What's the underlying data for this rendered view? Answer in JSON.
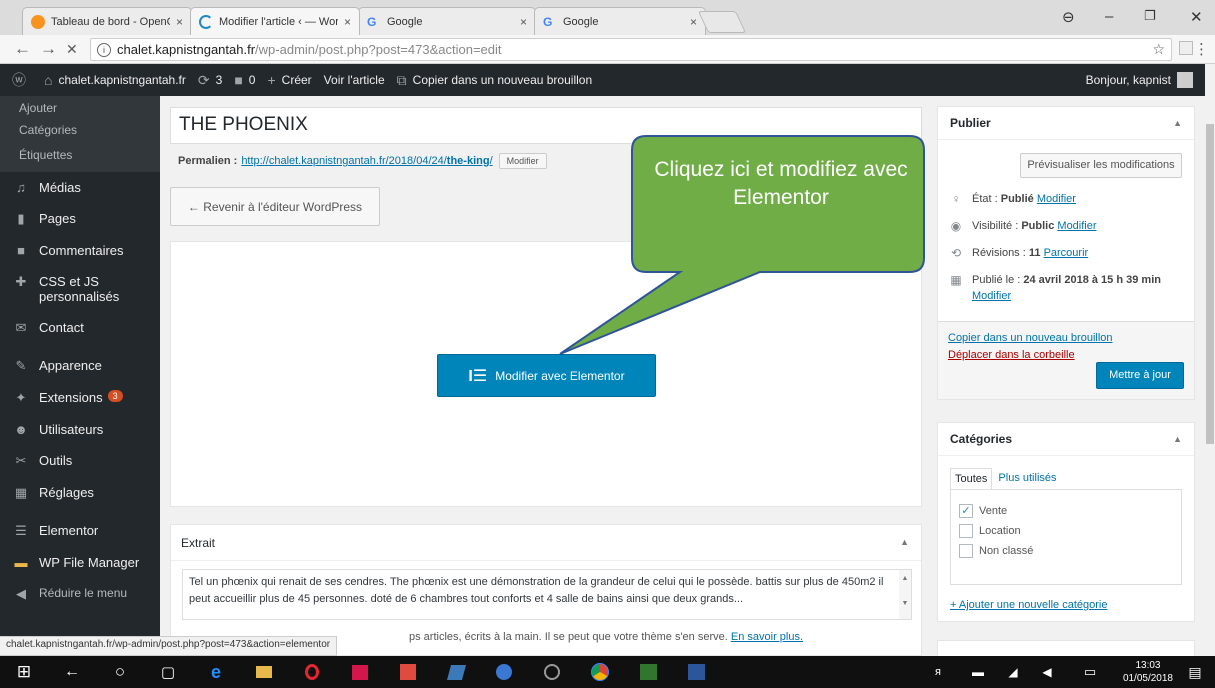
{
  "browser": {
    "tabs": [
      {
        "title": "Tableau de bord - OpenC",
        "favicon_color": "#f7931e"
      },
      {
        "title": "Modifier l'article ‹ — Wor",
        "favicon_color": "#1e8cbe"
      },
      {
        "title": "Google",
        "favicon_color": "#4285f4"
      },
      {
        "title": "Google",
        "favicon_color": "#4285f4"
      }
    ],
    "tab_close": "×",
    "url_host": "chalet.kapnistngantah.fr",
    "url_path": "/wp-admin/post.php?post=473&action=edit",
    "info_glyph": "i",
    "back_glyph": "←",
    "forward_glyph": "→",
    "stop_glyph": "✕",
    "star_glyph": "☆",
    "menu_glyph": "⋮",
    "win_user": "⊖",
    "win_min": "–",
    "win_max": "❐",
    "win_close": "✕"
  },
  "adminbar": {
    "wp_logo": "ⓦ",
    "home_icon": "⌂",
    "site": "chalet.kapnistngantah.fr",
    "updates_icon": "⟳",
    "updates": "3",
    "comments_icon": "■",
    "comments": "0",
    "new_icon": "+",
    "new": "Créer",
    "view": "Voir l'article",
    "copy_icon": "⧉",
    "copy": "Copier dans un nouveau brouillon",
    "greeting": "Bonjour, kapnist"
  },
  "sidebar": {
    "sub_items": [
      "Ajouter",
      "Catégories",
      "Étiquettes"
    ],
    "items": [
      {
        "label": "Médias",
        "icon": "♫"
      },
      {
        "label": "Pages",
        "icon": "▮"
      },
      {
        "label": "Commentaires",
        "icon": "■"
      },
      {
        "label": "CSS et JS personnalisés",
        "icon": "✚"
      },
      {
        "label": "Contact",
        "icon": "✉"
      },
      {
        "label": "Apparence",
        "icon": "✎"
      },
      {
        "label": "Extensions",
        "icon": "✦",
        "badge": "3"
      },
      {
        "label": "Utilisateurs",
        "icon": "☻"
      },
      {
        "label": "Outils",
        "icon": "✂"
      },
      {
        "label": "Réglages",
        "icon": "▦"
      },
      {
        "label": "Elementor",
        "icon": "☰"
      },
      {
        "label": "WP File Manager",
        "icon": "▬"
      },
      {
        "label": "Réduire le menu",
        "icon": "◀"
      }
    ]
  },
  "post": {
    "title": "THE PHOENIX",
    "permalink_label": "Permalien :",
    "permalink_base": "http://chalet.kapnistngantah.fr/2018/04/24/",
    "permalink_slug": "the-king",
    "permalink_end": "/",
    "permalink_edit": "Modifier",
    "back_button": "← Revenir à l'éditeur WordPress",
    "elementor_icon": "I☰",
    "elementor_button": "Modifier avec Elementor"
  },
  "callout": {
    "text": "Cliquez ici et modifiez avec Elementor",
    "fill": "#70ad47",
    "stroke": "#2f5597"
  },
  "excerpt": {
    "title": "Extrait",
    "toggle": "▲",
    "text": "Tel un phœnix qui renait de ses cendres. The phœnix est une démonstration de la grandeur de celui qui le possède. battis sur plus de 450m2 il peut accueillir plus de 45 personnes. doté de 6 chambres tout conforts et 4 salle de bains ainsi que deux grands...",
    "help": "ps articles, écrits à la main. Il se peut que votre thème s'en serve.",
    "help_link": "En savoir plus.",
    "scroll_up": "▲",
    "scroll_down": "▼"
  },
  "publish": {
    "title": "Publier",
    "toggle": "▲",
    "preview": "Prévisualiser les modifications",
    "status_icon": "♀",
    "status_label": "État :",
    "status_value": "Publié",
    "status_link": "Modifier",
    "visibility_icon": "◉",
    "visibility_label": "Visibilité :",
    "visibility_value": "Public",
    "visibility_link": "Modifier",
    "revisions_icon": "⟲",
    "revisions_label": "Révisions :",
    "revisions_value": "11",
    "revisions_link": "Parcourir",
    "date_icon": "▦",
    "date_label": "Publié le :",
    "date_value": "24 avril 2018 à 15 h 39 min",
    "date_link": "Modifier",
    "copy": "Copier dans un nouveau brouillon",
    "trash": "Déplacer dans la corbeille",
    "update": "Mettre à jour"
  },
  "categories": {
    "title": "Catégories",
    "toggle": "▲",
    "tab_all": "Toutes",
    "tab_used": "Plus utilisés",
    "check": "✓",
    "items": [
      {
        "label": "Vente",
        "checked": true
      },
      {
        "label": "Location",
        "checked": false
      },
      {
        "label": "Non classé",
        "checked": false
      }
    ],
    "add": "+ Ajouter une nouvelle catégorie"
  },
  "status_url": "chalet.kapnistngantah.fr/wp-admin/post.php?post=473&action=elementor",
  "taskbar": {
    "time": "13:03",
    "date": "01/05/2018",
    "start_glyph": "⊞",
    "back_glyph": "←",
    "cortana_glyph": "○",
    "taskview_glyph": "▢",
    "notify_glyph": "▤"
  }
}
